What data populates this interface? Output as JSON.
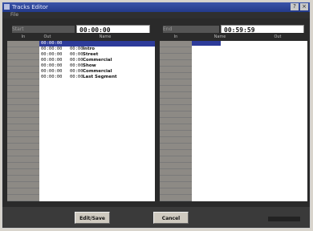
{
  "window": {
    "title": "Tracks Editor",
    "menu": "File"
  },
  "timecodes": {
    "start_label": "Start",
    "start_value": "00:00:00",
    "end_label": "End",
    "end_value": "00:59:59"
  },
  "left_list": {
    "headers": [
      "In",
      "Out",
      "Name"
    ],
    "rows": [
      {
        "t1": "00:00:00",
        "t2": "",
        "name": "",
        "selected": true
      },
      {
        "t1": "00:00:00",
        "t2": "00:00",
        "name": "Intro"
      },
      {
        "t1": "00:00:00",
        "t2": "00:00",
        "name": "Street"
      },
      {
        "t1": "00:00:00",
        "t2": "00:00",
        "name": "Commercial"
      },
      {
        "t1": "00:00:00",
        "t2": "00:00",
        "name": "Show"
      },
      {
        "t1": "00:00:00",
        "t2": "00:00",
        "name": "Commercial"
      },
      {
        "t1": "00:00:00",
        "t2": "00:00",
        "name": "Last Segment"
      }
    ]
  },
  "right_list": {
    "headers": [
      "In",
      "Name",
      "Out"
    ]
  },
  "buttons": {
    "ok_label": "Edit/Save",
    "cancel_label": "Cancel"
  }
}
